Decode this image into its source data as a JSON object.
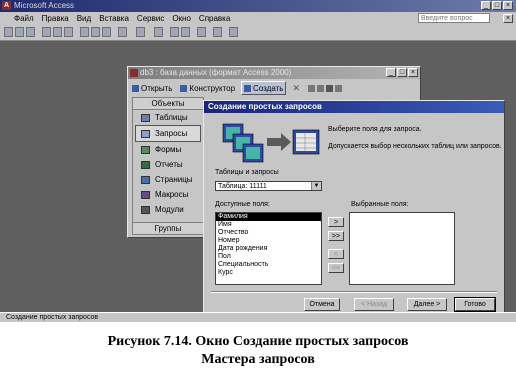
{
  "app": {
    "title": "Microsoft Access",
    "help_placeholder": "Введите вопрос",
    "menu": [
      "Файл",
      "Правка",
      "Вид",
      "Вставка",
      "Сервис",
      "Окно",
      "Справка"
    ]
  },
  "db_window": {
    "title": "db3 : база данных (формат Access 2000)",
    "toolbar": {
      "open": "Открыть",
      "design": "Конструктор",
      "create": "Создать"
    },
    "objects_header": "Объекты",
    "objects": [
      "Таблицы",
      "Запросы",
      "Формы",
      "Отчеты",
      "Страницы",
      "Макросы",
      "Модули"
    ],
    "selected_object": "Запросы",
    "groups_label": "Группы"
  },
  "wizard": {
    "title": "Создание простых запросов",
    "prompt": "Выберите поля для запроса.",
    "hint": "Допускается выбор нескольких таблиц или запросов.",
    "tables_label": "Таблицы и запросы",
    "table_value": "Таблица: 11111",
    "available_label": "Доступные поля:",
    "selected_label": "Выбранные поля:",
    "available_fields": [
      "Фамилия",
      "Имя",
      "Отчество",
      "Номер",
      "Дата рождения",
      "Пол",
      "Специальность",
      "Курс"
    ],
    "selected_field_highlighted": "Фамилия",
    "move_buttons": [
      ">",
      ">>",
      "<",
      "<<"
    ],
    "buttons": {
      "cancel": "Отмена",
      "back": "< Назад",
      "next": "Далее >",
      "finish": "Готово"
    }
  },
  "status_bar": {
    "text": "Создание простых запросов"
  },
  "caption": {
    "line1": "Рисунок 7.14. Окно Создание простых запросов",
    "line2": "Мастера запросов"
  }
}
